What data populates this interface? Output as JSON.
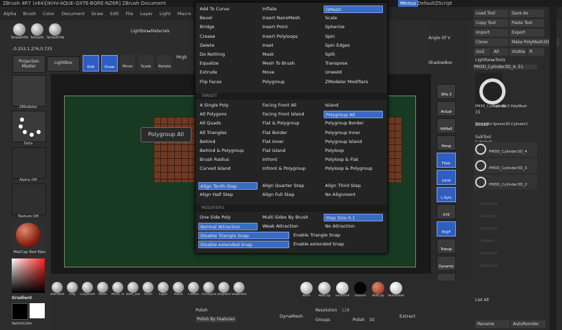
{
  "titlebar": {
    "text": "ZBrush 4R7 (x64)[IKHV-AQUE-QXTE-BQRE-NZKR]    ZBrush Document",
    "menus_label": "Menus",
    "script_label": "DefaultZScript"
  },
  "menubar": [
    "Alpha",
    "Brush",
    "Color",
    "Document",
    "Draw",
    "Edit",
    "File",
    "Layer",
    "Light",
    "Macro",
    "Marker",
    "Material"
  ],
  "top_tools": {
    "brush_labels": [
      "SmoothPe",
      "Smooth",
      "SmoothVe"
    ],
    "coords": "-0.253,1.276,0.733",
    "projection_master": "Projection Master",
    "lightbox": "LightBox",
    "lightbox_materials": "Lightbox▸Materials",
    "buttons": [
      "Edit",
      "Draw",
      "Move",
      "Scale",
      "Rotate"
    ],
    "mrgb": "Mrgb"
  },
  "left_panel": {
    "items": [
      "ZModeler",
      "Dots",
      "Alpha Off",
      "Texture Off",
      "MatCap Red Wax",
      "Gradient",
      "SwitchColor"
    ]
  },
  "tooltip": "Polygroup All",
  "menu": {
    "col1": [
      "Add To Curve",
      "Bevel",
      "Bridge",
      "Crease",
      "Delete",
      "Do Nothing",
      "Equalize",
      "Extrude",
      "Flip Faces"
    ],
    "col2": [
      "Inflate",
      "Insert NanoMesh",
      "Insert Point",
      "Insert Polyloops",
      "Inset",
      "Mask",
      "Mesh To Brush",
      "Move",
      "Polygroup"
    ],
    "col3": [
      "QMesh",
      "Scale",
      "Spherize",
      "Spin",
      "Spin Edges",
      "Split",
      "Transpose",
      "Unweld",
      "ZModeler Modifiers"
    ],
    "target_title": "TARGET",
    "target_col1": [
      "A Single Poly",
      "All Polygons",
      "All Quads",
      "All Triangles",
      "Behind",
      "Behind & Polygroup",
      "Brush Radius",
      "Curved Island"
    ],
    "target_col2": [
      "Facing Front All",
      "Facing Front Island",
      "Flat & Polygroup",
      "Flat Border",
      "Flat Inner",
      "Flat Island",
      "Infront",
      "Infront & Polygroup"
    ],
    "target_col3": [
      "Island",
      "Polygroup All",
      "Polygroup Border",
      "Polygroup Inner",
      "Polygroup Island",
      "Polyloop",
      "Polyloop & Flat",
      "Polyloop & Polygroup"
    ],
    "align_col1": [
      "Align Tenth Step",
      "Align Half Step"
    ],
    "align_col2": [
      "Align Quarter Step",
      "Align Full Step"
    ],
    "align_col3": [
      "Align Third Step",
      "No Alignment"
    ],
    "modifiers_title": "MODIFIERS",
    "mod_row1": [
      "One Side Poly",
      "Multi Sides By Brush",
      "Step Size 0.1"
    ],
    "mod_row2": [
      "Normal Attraction",
      "Weak Attraction",
      "No Attraction"
    ],
    "mod_row3": [
      "Disable Triangle Snap",
      "Enable Triangle Snap"
    ],
    "mod_row4": [
      "Disable extended Snap",
      "Enable extended Snap"
    ]
  },
  "right_dock": [
    "Angle Of V",
    "ShadowBox",
    "SPix 3",
    "Actual",
    "AAHalf",
    "Persp",
    "Floor",
    "Local",
    "L.Sym",
    "XYZ",
    "PolyF",
    "Transp",
    "Dynamic",
    "Solo",
    "Frame",
    "Scale"
  ],
  "right_panel": {
    "buttons": [
      "Load Tool",
      "Save As",
      "Copy Tool",
      "Paste Tool",
      "Import",
      "Export",
      "Clone",
      "Make PolyMesh3D",
      "GoZ",
      "All",
      "Visible",
      "R"
    ],
    "lightbox_tools": "Lightbox▸Tools",
    "current_tool": "PM3D_Cylinder3D_4. 51",
    "tools": [
      "PM3D_Cylinder3D",
      "Cylinder3",
      "PolyMesh",
      "SimpleBrt",
      "Sphere3D",
      "Cylinder3",
      "Cylinder3"
    ],
    "tool_count": "15",
    "tool_count2": "50322",
    "subtool_title": "SubTool",
    "subtools": [
      "PM3D_Cylinder3D_4",
      "PM3D_Cylinder3D_3",
      "PM3D_Cylinder3D_2"
    ],
    "empty_slots": [
      "Subtool 4",
      "Subtool 5",
      "Subtool 6",
      "Subtool 7",
      "Subtool 8",
      "Subtool 9"
    ],
    "list_all": "List All",
    "rename": "Rename",
    "autoreorder": "AutoReorder"
  },
  "bottom_bar": {
    "brushes": [
      "Standard",
      "Clay",
      "ClayBuildup",
      "Move",
      "Move To",
      "Dam_Sta",
      "Pinch",
      "Layer",
      "Polish",
      "Flatten",
      "TrimDyna",
      "Displace",
      "SnakeHoo"
    ],
    "materials": [
      "Blinn",
      "MatCap",
      "SilverFoil",
      "Outline",
      "MatCap",
      "SkinShade"
    ],
    "polish": "Polish",
    "polish_features": "Polish By Features",
    "dynamesh": "DynaMesh",
    "resolution_label": "Resolution",
    "resolution": "128",
    "groups": "Groups",
    "polish2": "Polish",
    "polish_val": "10",
    "extract": "Extract"
  },
  "colors": {
    "accent": "#3a6bc4",
    "floor": "#183a22",
    "mesh": "#6e3a24"
  }
}
